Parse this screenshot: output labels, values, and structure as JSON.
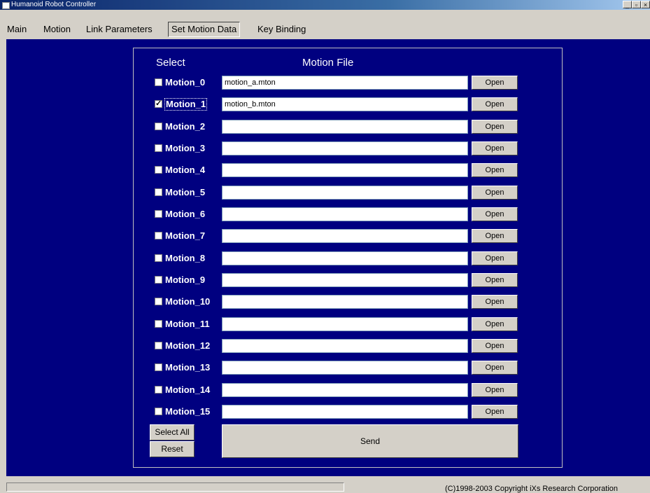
{
  "window": {
    "title": "Humanoid Robot Controller",
    "controls": [
      "_",
      "▫",
      "×"
    ]
  },
  "menu": {
    "items": [
      {
        "label": "Main"
      },
      {
        "label": "Motion"
      },
      {
        "label": "Link Parameters"
      },
      {
        "label": "Set Motion Data",
        "active": true
      },
      {
        "label": "Key Binding"
      }
    ]
  },
  "panel": {
    "select_header": "Select",
    "file_header": "Motion File",
    "open_label": "Open",
    "rows": [
      {
        "label": "Motion_0",
        "checked": false,
        "file": "motion_a.mton"
      },
      {
        "label": "Motion_1",
        "checked": true,
        "file": "motion_b.mton"
      },
      {
        "label": "Motion_2",
        "checked": false,
        "file": ""
      },
      {
        "label": "Motion_3",
        "checked": false,
        "file": ""
      },
      {
        "label": "Motion_4",
        "checked": false,
        "file": ""
      },
      {
        "label": "Motion_5",
        "checked": false,
        "file": ""
      },
      {
        "label": "Motion_6",
        "checked": false,
        "file": ""
      },
      {
        "label": "Motion_7",
        "checked": false,
        "file": ""
      },
      {
        "label": "Motion_8",
        "checked": false,
        "file": ""
      },
      {
        "label": "Motion_9",
        "checked": false,
        "file": ""
      },
      {
        "label": "Motion_10",
        "checked": false,
        "file": ""
      },
      {
        "label": "Motion_11",
        "checked": false,
        "file": ""
      },
      {
        "label": "Motion_12",
        "checked": false,
        "file": ""
      },
      {
        "label": "Motion_13",
        "checked": false,
        "file": ""
      },
      {
        "label": "Motion_14",
        "checked": false,
        "file": ""
      },
      {
        "label": "Motion_15",
        "checked": false,
        "file": ""
      }
    ],
    "select_all_label": "Select All",
    "reset_label": "Reset",
    "send_label": "Send"
  },
  "status": {
    "copyright": "(C)1998-2003  Copyright iXs Research Corporation"
  },
  "colors": {
    "background": "#000080",
    "chrome": "#d4d0c8"
  }
}
